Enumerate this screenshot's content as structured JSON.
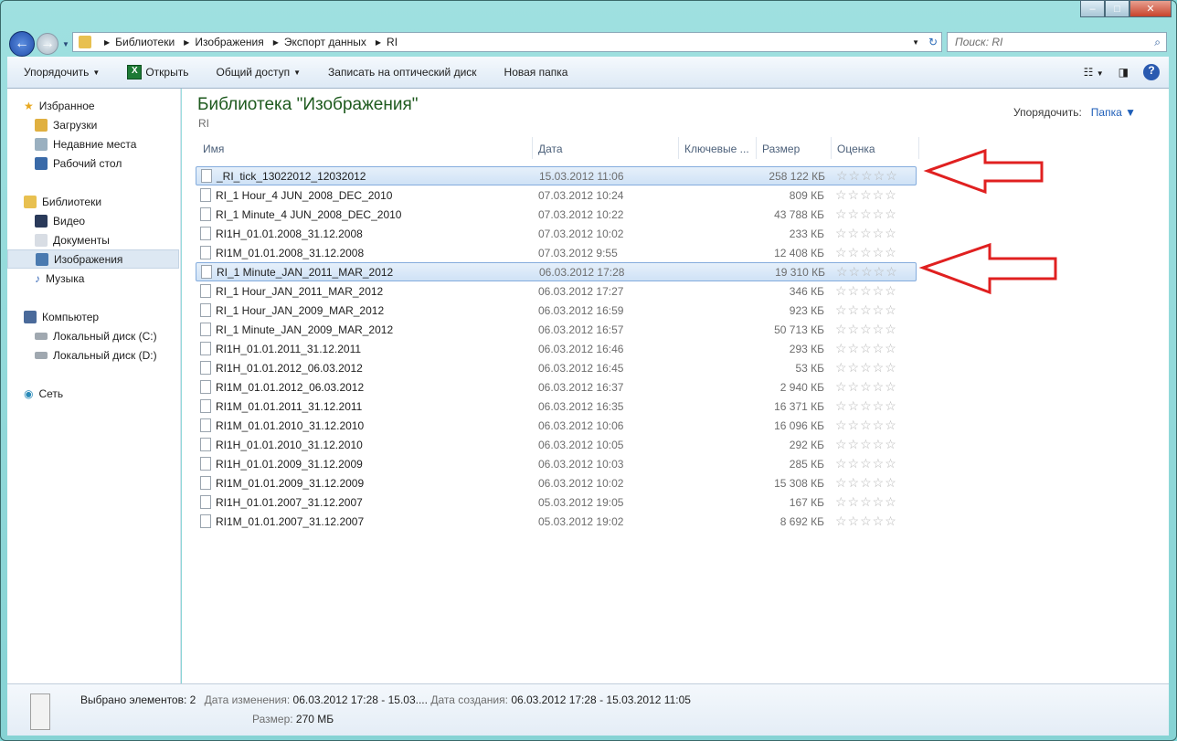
{
  "window": {
    "min": "–",
    "max": "□",
    "close": "✕"
  },
  "address": {
    "crumbs": [
      "Библиотеки",
      "Изображения",
      "Экспорт данных",
      "RI"
    ]
  },
  "search": {
    "placeholder": "Поиск: RI"
  },
  "toolbar": {
    "organize": "Упорядочить",
    "open": "Открыть",
    "share": "Общий доступ",
    "burn": "Записать на оптический диск",
    "new_folder": "Новая папка"
  },
  "sidebar": {
    "favorites": "Избранное",
    "downloads": "Загрузки",
    "recent": "Недавние места",
    "desktop": "Рабочий стол",
    "libraries": "Библиотеки",
    "video": "Видео",
    "documents": "Документы",
    "images": "Изображения",
    "music": "Музыка",
    "computer": "Компьютер",
    "disk_c": "Локальный диск (C:)",
    "disk_d": "Локальный диск (D:)",
    "network": "Сеть"
  },
  "library": {
    "title": "Библиотека \"Изображения\"",
    "subtitle": "RI",
    "arrange_label": "Упорядочить:",
    "arrange_value": "Папка"
  },
  "columns": [
    "Имя",
    "Дата",
    "Ключевые ...",
    "Размер",
    "Оценка"
  ],
  "files": [
    {
      "name": "_RI_tick_13022012_12032012",
      "date": "15.03.2012 11:06",
      "size": "258 122 КБ",
      "selected": true
    },
    {
      "name": "RI_1 Hour_4 JUN_2008_DEC_2010",
      "date": "07.03.2012 10:24",
      "size": "809 КБ"
    },
    {
      "name": "RI_1 Minute_4 JUN_2008_DEC_2010",
      "date": "07.03.2012 10:22",
      "size": "43 788 КБ"
    },
    {
      "name": "RI1H_01.01.2008_31.12.2008",
      "date": "07.03.2012 10:02",
      "size": "233 КБ"
    },
    {
      "name": "RI1M_01.01.2008_31.12.2008",
      "date": "07.03.2012 9:55",
      "size": "12 408 КБ"
    },
    {
      "name": "RI_1 Minute_JAN_2011_MAR_2012",
      "date": "06.03.2012 17:28",
      "size": "19 310 КБ",
      "selected": true
    },
    {
      "name": "RI_1 Hour_JAN_2011_MAR_2012",
      "date": "06.03.2012 17:27",
      "size": "346 КБ"
    },
    {
      "name": "RI_1 Hour_JAN_2009_MAR_2012",
      "date": "06.03.2012 16:59",
      "size": "923 КБ"
    },
    {
      "name": "RI_1 Minute_JAN_2009_MAR_2012",
      "date": "06.03.2012 16:57",
      "size": "50 713 КБ"
    },
    {
      "name": "RI1H_01.01.2011_31.12.2011",
      "date": "06.03.2012 16:46",
      "size": "293 КБ"
    },
    {
      "name": "RI1H_01.01.2012_06.03.2012",
      "date": "06.03.2012 16:45",
      "size": "53 КБ"
    },
    {
      "name": "RI1M_01.01.2012_06.03.2012",
      "date": "06.03.2012 16:37",
      "size": "2 940 КБ"
    },
    {
      "name": "RI1M_01.01.2011_31.12.2011",
      "date": "06.03.2012 16:35",
      "size": "16 371 КБ"
    },
    {
      "name": "RI1M_01.01.2010_31.12.2010",
      "date": "06.03.2012 10:06",
      "size": "16 096 КБ"
    },
    {
      "name": "RI1H_01.01.2010_31.12.2010",
      "date": "06.03.2012 10:05",
      "size": "292 КБ"
    },
    {
      "name": "RI1H_01.01.2009_31.12.2009",
      "date": "06.03.2012 10:03",
      "size": "285 КБ"
    },
    {
      "name": "RI1M_01.01.2009_31.12.2009",
      "date": "06.03.2012 10:02",
      "size": "15 308 КБ"
    },
    {
      "name": "RI1H_01.01.2007_31.12.2007",
      "date": "05.03.2012 19:05",
      "size": "167 КБ"
    },
    {
      "name": "RI1M_01.01.2007_31.12.2007",
      "date": "05.03.2012 19:02",
      "size": "8 692 КБ"
    }
  ],
  "status": {
    "selected": "Выбрано элементов: 2",
    "modified_label": "Дата изменения:",
    "modified": "06.03.2012 17:28 - 15.03....",
    "created_label": "Дата создания:",
    "created": "06.03.2012 17:28 - 15.03.2012 11:05",
    "size_label": "Размер:",
    "size": "270 МБ"
  }
}
